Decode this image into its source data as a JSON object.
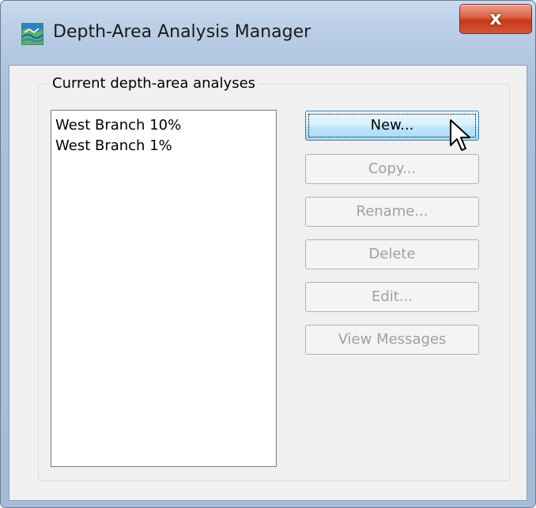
{
  "window": {
    "title": "Depth-Area Analysis Manager",
    "close_label": "x"
  },
  "group": {
    "label": "Current depth-area analyses"
  },
  "analyses": [
    "West Branch 10%",
    "West Branch 1%"
  ],
  "buttons": {
    "new": "New...",
    "copy": "Copy...",
    "rename": "Rename...",
    "delete": "Delete",
    "edit": "Edit...",
    "view_messages": "View Messages"
  },
  "button_states": {
    "new": "enabled-hover-focused",
    "copy": "disabled",
    "rename": "disabled",
    "delete": "disabled",
    "edit": "disabled",
    "view_messages": "disabled"
  },
  "icons": {
    "app": "depth-area-app-icon",
    "close": "close-icon",
    "cursor": "mouse-pointer-icon"
  },
  "colors": {
    "title_bar": "#b9cde5",
    "close_button": "#c7381a",
    "active_button": "#bee6fd",
    "disabled_text": "#a0a0a0"
  }
}
